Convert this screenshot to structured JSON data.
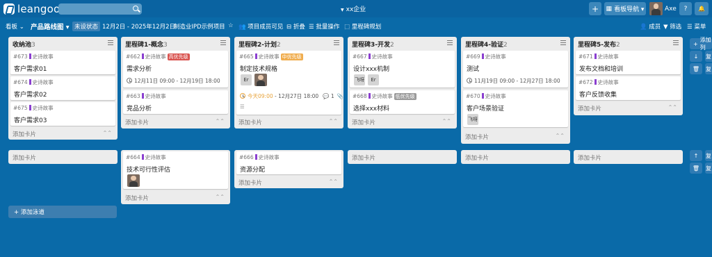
{
  "topbar": {
    "logo_text": "leangoo",
    "enterprise": "xx企业",
    "enterprise_caret": "▼",
    "plus": "+",
    "grid": "▦",
    "board_nav": "看板导航 ▾",
    "user_name": "Axe",
    "help": "?",
    "bell": "🔔"
  },
  "subbar": {
    "board_menu": "看板 ⌄",
    "view_menu": "产品路线图 ▾",
    "status_pill": "未设状态",
    "date_range": "12月2日 - 2025年12月2日",
    "project": "制造业IPD示例项目",
    "star": "☆",
    "visibility": "👥 项目成员可见",
    "fold": "⊟ 折叠",
    "batch": "☰ 批量操作",
    "milestone": "⬚ 里程碑规划",
    "members": "👤 成员",
    "filter": "▼ 筛选",
    "menu": "☰ 菜单"
  },
  "common": {
    "story_label": "史诗故事",
    "add_card": "添加卡片",
    "collapse": "⌃⌃",
    "add_lane": "+ 添加泳道"
  },
  "columns": [
    {
      "title": "收纳池",
      "count": "3"
    },
    {
      "title": "里程碑1-概念",
      "count": "3"
    },
    {
      "title": "里程碑2-计划",
      "count": "2"
    },
    {
      "title": "里程碑3-开发",
      "count": "2"
    },
    {
      "title": "里程碑4-验证",
      "count": "2"
    },
    {
      "title": "里程碑5-发布",
      "count": "2"
    }
  ],
  "cards": {
    "c673": {
      "id": "#673",
      "title": "客户需求01"
    },
    "c674": {
      "id": "#674",
      "title": "客户需求02"
    },
    "c675": {
      "id": "#675",
      "title": "客户需求03"
    },
    "c662": {
      "id": "#662",
      "title": "需求分析",
      "tag": "高优先级",
      "date": "12月11日 09:00 - 12月19日 18:00"
    },
    "c663": {
      "id": "#663",
      "title": "竞品分析"
    },
    "c665": {
      "id": "#665",
      "title": "制定技术规格",
      "tag": "中优先级",
      "chip": "Er",
      "date_today": "今天09:00",
      "date_rest": " - 12月27日 18:00",
      "comments": "💬 1",
      "attach": "📎",
      "desc": "☰"
    },
    "c667": {
      "id": "#667",
      "title": "设计xxx机制",
      "chip1": "飞呀",
      "chip2": "Er"
    },
    "c668": {
      "id": "#668",
      "title": "选择xxx材料",
      "tag": "低优先级"
    },
    "c669": {
      "id": "#669",
      "title": "测试",
      "date": "11月19日 09:00 - 12月27日 18:00"
    },
    "c670": {
      "id": "#670",
      "title": "客户场景验证",
      "chip": "飞呀"
    },
    "c671": {
      "id": "#671",
      "title": "发布文档和培训"
    },
    "c672": {
      "id": "#672",
      "title": "客户反馈收集"
    },
    "c664": {
      "id": "#664",
      "title": "技术可行性评估"
    },
    "c666": {
      "id": "#666",
      "title": "资源分配"
    }
  },
  "side": {
    "add_list": "添加列",
    "copy": "复",
    "plus": "+",
    "down": "↓",
    "up": "↑",
    "trash": "🗑"
  },
  "colors": {
    "high": "#d9534f",
    "mid": "#f0ad4e",
    "low": "#9a9a9a",
    "story": "#8b3fd0",
    "board_bg": "#0a6aa8"
  }
}
